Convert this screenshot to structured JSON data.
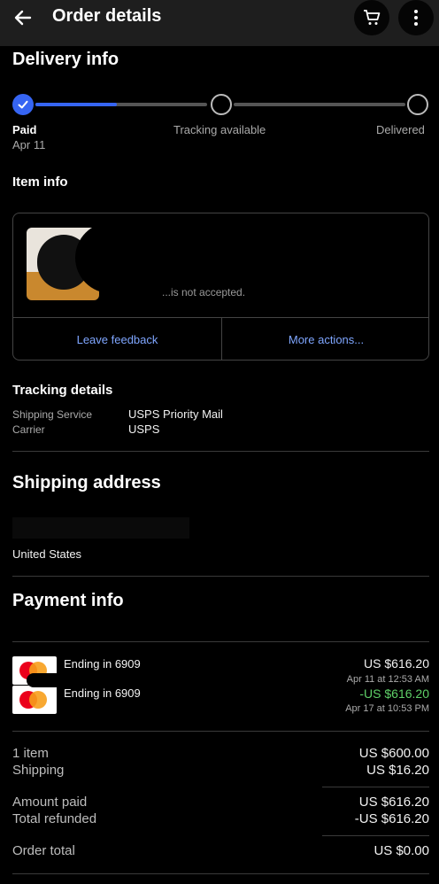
{
  "header": {
    "title": "Order details",
    "icons": [
      "back-arrow-icon",
      "cart-icon",
      "more-vertical-icon"
    ]
  },
  "delivery": {
    "title": "Delivery info",
    "steps": [
      {
        "label": "Paid",
        "date": "Apr 11",
        "done": true
      },
      {
        "label": "Tracking available",
        "done": false
      },
      {
        "label": "Delivered",
        "done": false
      }
    ],
    "progress_fraction": 0.22
  },
  "item": {
    "title": "Item info",
    "note": "...is not accepted.",
    "leave_feedback": "Leave feedback",
    "more_actions": "More actions..."
  },
  "tracking": {
    "title": "Tracking details",
    "rows": [
      {
        "key": "Shipping Service",
        "value": "USPS Priority Mail"
      },
      {
        "key": "Carrier",
        "value": "USPS"
      }
    ]
  },
  "shipping": {
    "title": "Shipping address",
    "country": "United States"
  },
  "payment": {
    "title": "Payment info",
    "methods": [
      {
        "label": "Ending in 6909",
        "amount": "US $616.20",
        "date": "Apr 11 at 12:53 AM",
        "refund": false
      },
      {
        "label": "Ending in 6909",
        "amount": "-US $616.20",
        "date": "Apr 17 at 10:53 PM",
        "refund": true
      }
    ]
  },
  "summary": {
    "items_label": "1 item",
    "items_value": "US $600.00",
    "shipping_label": "Shipping",
    "shipping_value": "US $16.20",
    "paid_label": "Amount paid",
    "paid_value": "US $616.20",
    "refunded_label": "Total refunded",
    "refunded_value": "-US $616.20",
    "total_label": "Order total",
    "total_value": "US $0.00"
  },
  "colors": {
    "accent": "#3665f3",
    "link": "#7fa6ff",
    "refund_green": "#5fd068",
    "background": "#000000"
  }
}
